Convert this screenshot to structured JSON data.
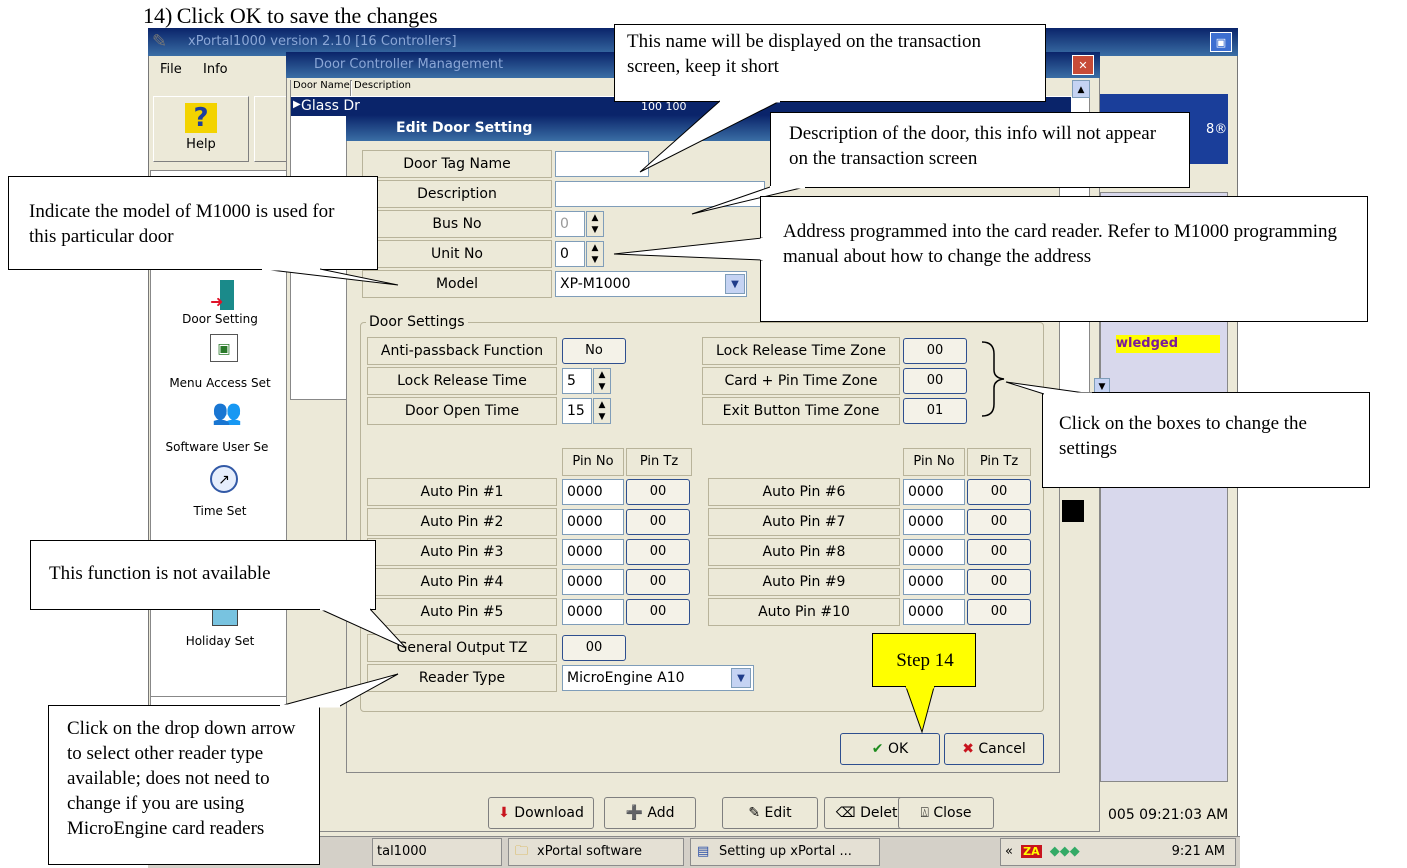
{
  "heading": "14) Click OK to save the changes",
  "main_window": {
    "title": "xPortal1000 version 2.10 [16 Controllers]"
  },
  "menu": {
    "file": "File",
    "info": "Info"
  },
  "help_button": "Help",
  "door_mgmt": {
    "title": "Door Controller Management",
    "col_name": "Door Name",
    "col_desc": "Description",
    "row_name": "Glass Dr",
    "row_vals": "100     100"
  },
  "sidebar": {
    "door_setting": "Door Setting",
    "menu_access": "Menu Access Set",
    "software_user": "Software User Se",
    "time_set": "Time Set",
    "holiday_set": "Holiday Set"
  },
  "dialog": {
    "title": "Edit Door Setting",
    "door_tag_label": "Door Tag Name",
    "description_label": "Description",
    "bus_no_label": "Bus No",
    "bus_no_value": "0",
    "unit_no_label": "Unit No",
    "unit_no_value": "0",
    "model_label": "Model",
    "model_value": "XP-M1000",
    "group_title": "Door Settings",
    "antipassback_label": "Anti-passback Function",
    "antipassback_value": "No",
    "lock_release_label": "Lock Release Time",
    "lock_release_value": "5",
    "door_open_label": "Door Open Time",
    "door_open_value": "15",
    "lr_tz_label": "Lock Release Time Zone",
    "lr_tz_value": "00",
    "cp_tz_label": "Card + Pin Time Zone",
    "cp_tz_value": "00",
    "eb_tz_label": "Exit Button Time Zone",
    "eb_tz_value": "01",
    "pin_no_hdr": "Pin No",
    "pin_tz_hdr": "Pin Tz",
    "auto_pins_left": [
      {
        "label": "Auto Pin #1",
        "pin": "0000",
        "tz": "00"
      },
      {
        "label": "Auto Pin #2",
        "pin": "0000",
        "tz": "00"
      },
      {
        "label": "Auto Pin #3",
        "pin": "0000",
        "tz": "00"
      },
      {
        "label": "Auto Pin #4",
        "pin": "0000",
        "tz": "00"
      },
      {
        "label": "Auto Pin #5",
        "pin": "0000",
        "tz": "00"
      }
    ],
    "auto_pins_right": [
      {
        "label": "Auto Pin #6",
        "pin": "0000",
        "tz": "00"
      },
      {
        "label": "Auto Pin #7",
        "pin": "0000",
        "tz": "00"
      },
      {
        "label": "Auto Pin #8",
        "pin": "0000",
        "tz": "00"
      },
      {
        "label": "Auto Pin #9",
        "pin": "0000",
        "tz": "00"
      },
      {
        "label": "Auto Pin #10",
        "pin": "0000",
        "tz": "00"
      }
    ],
    "general_output_label": "General Output TZ",
    "general_output_value": "00",
    "reader_type_label": "Reader Type",
    "reader_type_value": "MicroEngine A10",
    "ok": "OK",
    "cancel": "Cancel"
  },
  "toolbar": {
    "download": "Download",
    "add": "Add",
    "edit": "Edit",
    "delete": "Delete",
    "close": "Close"
  },
  "right_panel": {
    "alert": "wledged",
    "datetime": "005 09:21:03 AM"
  },
  "taskbar": {
    "item1": "tal1000",
    "item2": "xPortal software",
    "item3": "Setting up xPortal ...",
    "clock": "9:21 AM"
  },
  "callouts": {
    "tag_name": "This name will be displayed on the transaction screen, keep it short",
    "description": "Description of the door, this info will not appear on the transaction screen",
    "model": "Indicate the model of M1000 is used for this particular door",
    "address": "Address programmed into the card reader. Refer to M1000 programming manual about how to change the address",
    "boxes": "Click on the boxes to change the settings",
    "not_available": "This function is not available",
    "dropdown": "Click on the drop down arrow to select other reader type available; does not need to change if you are using MicroEngine card readers",
    "step": "Step 14"
  },
  "colors": {
    "title_bar": "#0a246a",
    "dialog_bg": "#ece9d8",
    "step_callout": "#ffff00",
    "right_panel": "#d8d8ec"
  }
}
